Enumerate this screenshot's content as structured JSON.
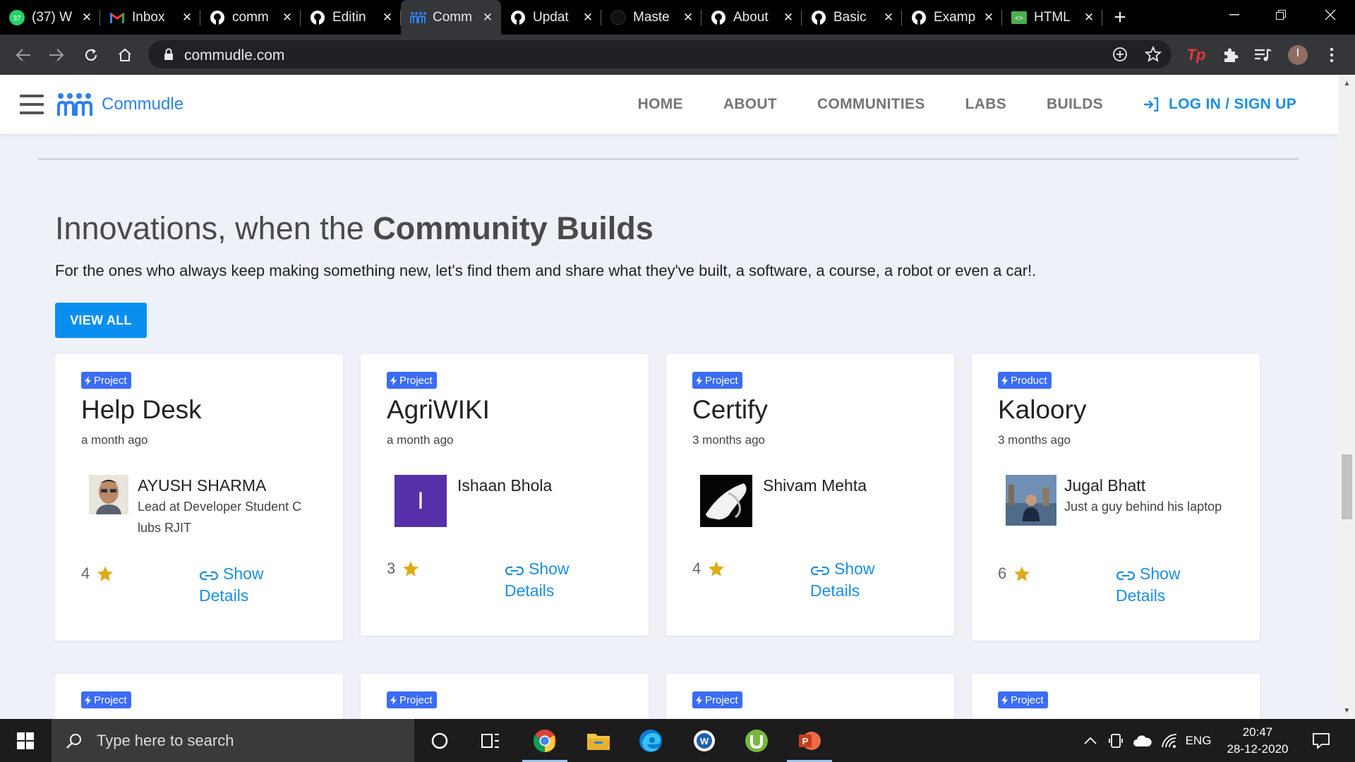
{
  "browser": {
    "tabs": [
      {
        "title": "(37) W",
        "icon": "whatsapp-icon",
        "active": false
      },
      {
        "title": "Inbox",
        "icon": "gmail-icon",
        "active": false
      },
      {
        "title": "comm",
        "icon": "github-icon",
        "active": false
      },
      {
        "title": "Editin",
        "icon": "github-icon",
        "active": false
      },
      {
        "title": "Comm",
        "icon": "commudle-icon",
        "active": true
      },
      {
        "title": "Updat",
        "icon": "github-icon",
        "active": false
      },
      {
        "title": "Maste",
        "icon": "github-icon",
        "active": false
      },
      {
        "title": "About",
        "icon": "github-icon",
        "active": false
      },
      {
        "title": "Basic",
        "icon": "github-icon",
        "active": false
      },
      {
        "title": "Examp",
        "icon": "github-icon",
        "active": false
      },
      {
        "title": "HTML",
        "icon": "html-icon",
        "active": false
      }
    ],
    "whatsapp_badge": "37",
    "url": "commudle.com",
    "profile_initial": "I",
    "extension_label": "Tp"
  },
  "header": {
    "brand": "Commudle",
    "nav": [
      "HOME",
      "ABOUT",
      "COMMUNITIES",
      "LABS",
      "BUILDS"
    ],
    "login": "LOG IN / SIGN UP"
  },
  "builds": {
    "heading_prefix": "Innovations, when the ",
    "heading_bold": "Community Builds",
    "subtitle": "For the ones who always keep making something new, let's find them and share what they've built, a software, a course, a robot or even a car!.",
    "view_all": "VIEW ALL",
    "show_details": "Show Details",
    "cards": [
      {
        "badge": "Project",
        "title": "Help Desk",
        "time": "a month ago",
        "author": "AYUSH SHARMA",
        "role": "Lead at Developer Student Clubs RJIT",
        "stars": "4"
      },
      {
        "badge": "Project",
        "title": "AgriWIKI",
        "time": "a month ago",
        "author": "Ishaan Bhola",
        "role": "",
        "avatar_letter": "I",
        "stars": "3"
      },
      {
        "badge": "Project",
        "title": "Certify",
        "time": "3 months ago",
        "author": "Shivam Mehta",
        "role": "",
        "stars": "4"
      },
      {
        "badge": "Product",
        "title": "Kaloory",
        "time": "3 months ago",
        "author": "Jugal Bhatt",
        "role": "Just a guy behind his laptop",
        "stars": "6"
      }
    ],
    "next_row_badges": [
      "Project",
      "Project",
      "Project",
      "Project"
    ]
  },
  "taskbar": {
    "search_placeholder": "Type here to search",
    "apps": [
      "cortana-icon",
      "task-view-icon",
      "chrome-icon",
      "file-explorer-icon",
      "edge-icon",
      "word-viewer-icon",
      "utorrent-icon",
      "powerpoint-icon"
    ],
    "language": "ENG",
    "time": "20:47",
    "date": "28-12-2020"
  },
  "colors": {
    "accent": "#1a8fe3",
    "badge": "#3b6cf5",
    "star": "#e0a913",
    "page_bg": "#eef1f8"
  }
}
